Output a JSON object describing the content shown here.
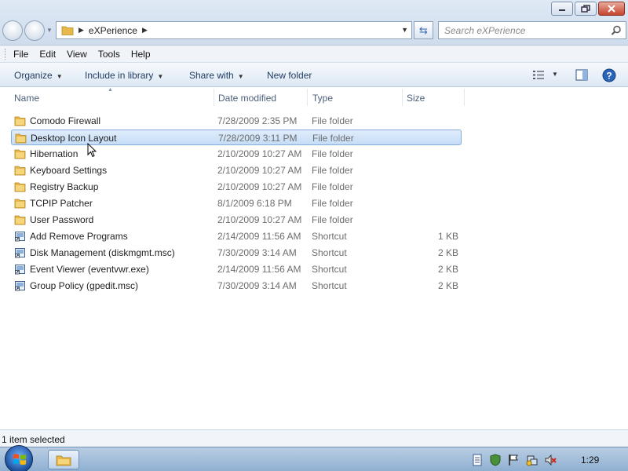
{
  "window": {
    "buttons": {
      "minimize": "minimize",
      "maximize": "restore",
      "close": "close"
    }
  },
  "address": {
    "path": [
      "eXPerience"
    ]
  },
  "search": {
    "placeholder": "Search eXPerience"
  },
  "menu": [
    "File",
    "Edit",
    "View",
    "Tools",
    "Help"
  ],
  "toolbar": {
    "organize": "Organize",
    "include_in_library": "Include in library",
    "share_with": "Share with",
    "new_folder": "New folder"
  },
  "columns": {
    "name": "Name",
    "date_modified": "Date modified",
    "type": "Type",
    "size": "Size"
  },
  "files": [
    {
      "name": "Comodo Firewall",
      "date": "7/28/2009 2:35 PM",
      "type": "File folder",
      "size": "",
      "icon": "folder-icon"
    },
    {
      "name": "Desktop Icon Layout",
      "date": "7/28/2009 3:11 PM",
      "type": "File folder",
      "size": "",
      "icon": "folder-icon",
      "selected": true
    },
    {
      "name": "Hibernation",
      "date": "2/10/2009 10:27 AM",
      "type": "File folder",
      "size": "",
      "icon": "folder-icon"
    },
    {
      "name": "Keyboard Settings",
      "date": "2/10/2009 10:27 AM",
      "type": "File folder",
      "size": "",
      "icon": "folder-icon"
    },
    {
      "name": "Registry Backup",
      "date": "2/10/2009 10:27 AM",
      "type": "File folder",
      "size": "",
      "icon": "folder-icon"
    },
    {
      "name": "TCPIP Patcher",
      "date": "8/1/2009 6:18 PM",
      "type": "File folder",
      "size": "",
      "icon": "folder-icon"
    },
    {
      "name": "User Password",
      "date": "2/10/2009 10:27 AM",
      "type": "File folder",
      "size": "",
      "icon": "folder-icon"
    },
    {
      "name": "Add Remove Programs",
      "date": "2/14/2009 11:56 AM",
      "type": "Shortcut",
      "size": "1 KB",
      "icon": "shortcut-icon"
    },
    {
      "name": "Disk Management (diskmgmt.msc)",
      "date": "7/30/2009 3:14 AM",
      "type": "Shortcut",
      "size": "2 KB",
      "icon": "shortcut-icon"
    },
    {
      "name": "Event Viewer (eventvwr.exe)",
      "date": "2/14/2009 11:56 AM",
      "type": "Shortcut",
      "size": "2 KB",
      "icon": "shortcut-icon"
    },
    {
      "name": "Group Policy (gpedit.msc)",
      "date": "7/30/2009 3:14 AM",
      "type": "Shortcut",
      "size": "2 KB",
      "icon": "shortcut-icon"
    }
  ],
  "status": {
    "text": "1 item selected"
  },
  "taskbar": {
    "clock": "1:29"
  },
  "colors": {
    "selection_bg": "#c5ddf7",
    "selection_border": "#84acdd",
    "folder_yellow": "#e8b94a",
    "taskbar_blue": "#8fb0d2"
  }
}
